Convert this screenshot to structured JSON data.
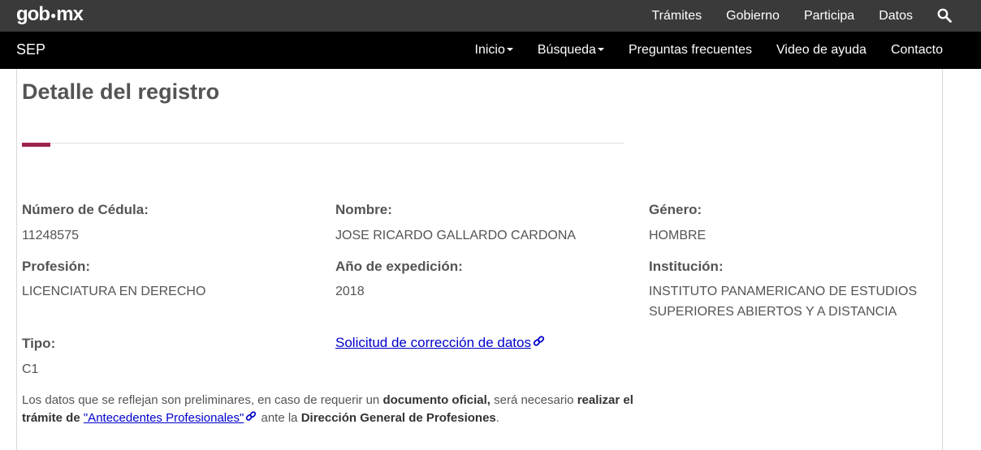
{
  "topbar": {
    "logo_left": "gob",
    "logo_right": "mx",
    "nav": [
      "Trámites",
      "Gobierno",
      "Participa",
      "Datos"
    ],
    "search_icon": "search-icon"
  },
  "sepbar": {
    "brand": "SEP",
    "nav": {
      "inicio": "Inicio",
      "busqueda": "Búsqueda",
      "faq": "Preguntas frecuentes",
      "video": "Video de ayuda",
      "contacto": "Contacto"
    }
  },
  "colors": {
    "accent": "#9d2449",
    "topbar": "#3a3a3a",
    "sepbar": "#000000",
    "link": "#0000cc"
  },
  "page": {
    "title": "Detalle del registro",
    "fields": {
      "cedula_label": "Número de Cédula:",
      "cedula_value": "11248575",
      "nombre_label": "Nombre:",
      "nombre_value": "JOSE RICARDO GALLARDO CARDONA",
      "genero_label": "Género:",
      "genero_value": "HOMBRE",
      "profesion_label": "Profesión:",
      "profesion_value": "LICENCIATURA EN DERECHO",
      "anio_label": "Año de expedición:",
      "anio_value": "2018",
      "institucion_label": "Institución:",
      "institucion_value_line1": "INSTITUTO PANAMERICANO DE ESTUDIOS",
      "institucion_value_line2": "SUPERIORES ABIERTOS Y A DISTANCIA",
      "tipo_label": "Tipo:",
      "tipo_value": "C1"
    },
    "correction_link": "Solicitud de corrección de datos",
    "footnote": {
      "part1": "Los datos que se reflejan son preliminares, en caso de requerir un ",
      "bold1": "documento oficial,",
      "part2": " será necesario ",
      "bold2": "realizar el trámite de ",
      "link": "\"Antecedentes Profesionales\"",
      "part3": " ante la ",
      "bold3": "Dirección General de Profesiones",
      "end": "."
    }
  }
}
